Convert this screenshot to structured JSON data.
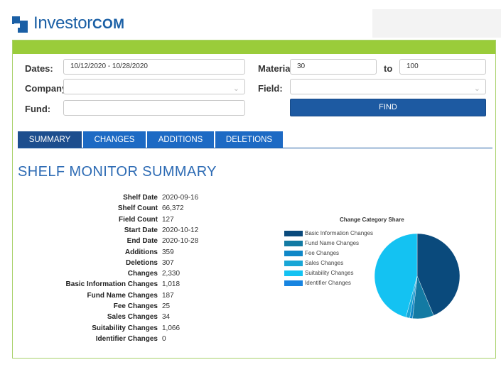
{
  "brand": {
    "name_main": "Investor",
    "name_suffix": "COM",
    "color": "#1a5fa5"
  },
  "filters": {
    "dates_label": "Dates:",
    "dates_value": "10/12/2020 - 10/28/2020",
    "company_label": "Company",
    "company_value": "",
    "fund_label": "Fund:",
    "fund_value": "",
    "materiality_label": "Materia",
    "materiality_from": "30",
    "to_label": "to",
    "materiality_to": "100",
    "field_label": "Field:",
    "field_value": "",
    "find_label": "FIND"
  },
  "tabs": [
    {
      "label": "SUMMARY",
      "active": true
    },
    {
      "label": "CHANGES",
      "active": false
    },
    {
      "label": "ADDITIONS",
      "active": false
    },
    {
      "label": "DELETIONS",
      "active": false
    }
  ],
  "summary": {
    "title": "SHELF MONITOR SUMMARY",
    "rows": [
      {
        "key": "Shelf Date",
        "value": "2020-09-16"
      },
      {
        "key": "Shelf Count",
        "value": "66,372"
      },
      {
        "key": "Field Count",
        "value": "127"
      },
      {
        "key": "Start Date",
        "value": "2020-10-12"
      },
      {
        "key": "End Date",
        "value": "2020-10-28"
      },
      {
        "key": "Additions",
        "value": "359"
      },
      {
        "key": "Deletions",
        "value": "307"
      },
      {
        "key": "Changes",
        "value": "2,330"
      },
      {
        "key": "Basic Information Changes",
        "value": "1,018"
      },
      {
        "key": "Fund Name Changes",
        "value": "187"
      },
      {
        "key": "Fee Changes",
        "value": "25"
      },
      {
        "key": "Sales Changes",
        "value": "34"
      },
      {
        "key": "Suitability Changes",
        "value": "1,066"
      },
      {
        "key": "Identifier Changes",
        "value": "0"
      }
    ]
  },
  "chart_data": {
    "type": "pie",
    "title": "Change Category Share",
    "legend_position": "left",
    "categories": [
      "Basic Information Changes",
      "Fund Name Changes",
      "Fee Changes",
      "Sales Changes",
      "Suitability Changes",
      "Identifier Changes"
    ],
    "values": [
      1018,
      187,
      25,
      34,
      1066,
      0
    ],
    "colors": [
      "#0a4a7c",
      "#137aa3",
      "#0f87c7",
      "#19a6d6",
      "#14c2f2",
      "#1784e0"
    ]
  },
  "colors": {
    "accent_green": "#9acc3a",
    "tab_blue": "#1d6ac4",
    "tab_active": "#1d4e8e",
    "button_blue": "#1d5aa2",
    "title_blue": "#2d6bb4"
  }
}
